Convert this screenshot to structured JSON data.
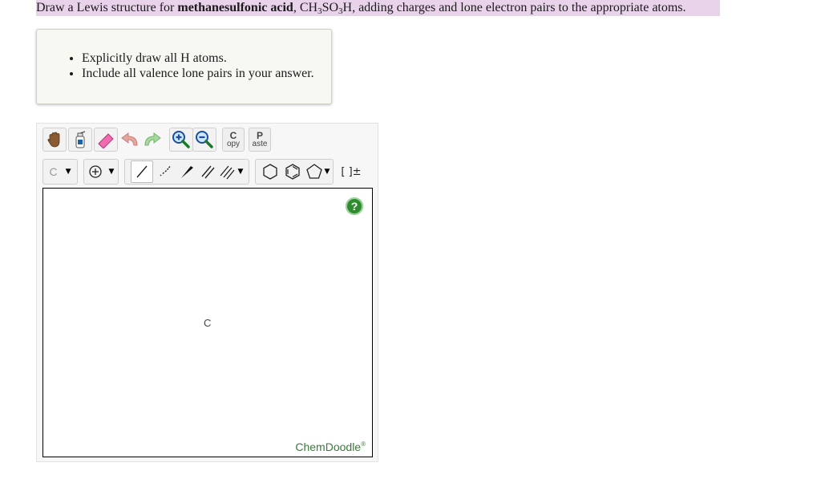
{
  "question": {
    "prefix": "Draw a Lewis structure for ",
    "compound": "methanesulfonic acid",
    "comma": ", ",
    "formula": {
      "ch": "CH",
      "sub1": "3",
      "so": "SO",
      "sub2": "3",
      "h": "H"
    },
    "suffix": ", adding charges and lone electron pairs to the appropriate atoms."
  },
  "hints": [
    "Explicitly draw all H atoms.",
    "Include all valence lone pairs in your answer."
  ],
  "toolbar": {
    "copy": {
      "big": "C",
      "small": "opy"
    },
    "paste": {
      "big": "P",
      "small": "aste"
    },
    "element_select": {
      "value": "C"
    },
    "bracket_label": "[ ]±"
  },
  "canvas": {
    "atom_label": "C",
    "help_label": "?",
    "brand": "ChemDoodle",
    "brand_mark": "®"
  }
}
